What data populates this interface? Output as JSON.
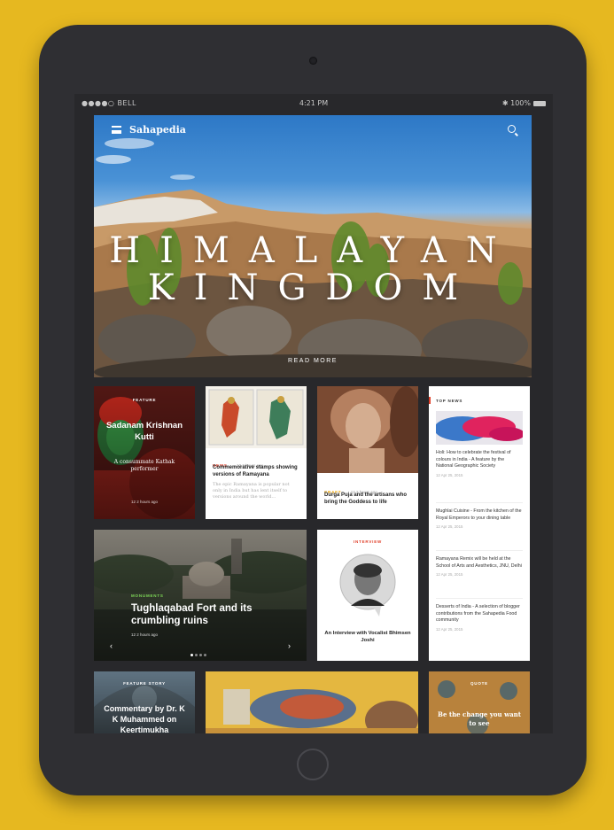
{
  "status_bar": {
    "carrier": "●●●●○ BELL",
    "time": "4:21 PM",
    "battery": "100%"
  },
  "app": {
    "logo": "Sahapedia"
  },
  "hero": {
    "title_line1": "HIMALAYAN",
    "title_line2": "KINGDOM",
    "cta": "READ MORE"
  },
  "cards": {
    "feature": {
      "tag": "FEATURE",
      "title": "Sadanam Krishnan Kutti",
      "subtitle": "A consummate Kathak performer",
      "meta": "12  2 hours ago"
    },
    "stamps": {
      "tag": "NEWS",
      "meta": "12   2 hours ago",
      "title": "Commemorative stamps showing versions of Ramayana",
      "excerpt": "The epic Ramayana is popular not only in India but has lent itself to versions around the world..."
    },
    "durga": {
      "tag": "CRAFT",
      "meta": "12   2 hours ago",
      "title": "Durga Puja and the artisans who bring the Goddess to life"
    },
    "top_news": {
      "heading": "TOP NEWS",
      "items": [
        {
          "title": "Holi: How to celebrate the festival of colours in India - A feature by the National Geographic Society",
          "meta": "12   Apr 25, 2015"
        },
        {
          "title": "Mughlai Cuisine - From the kitchen of the Royal Emperors to your dining table",
          "meta": "12   Apr 25, 2015"
        },
        {
          "title": "Ramayana Remix will be held at the School of Arts and Aesthetics, JNU, Delhi",
          "meta": "12   Apr 25, 2015"
        },
        {
          "title": "Desserts of India - A selection of blogger contributions from the Sahapedia Food community",
          "meta": "12   Apr 25, 2015"
        }
      ]
    },
    "monument": {
      "tag": "MONUMENTS",
      "title": "Tughlaqabad Fort and its crumbling ruins",
      "meta": "12   2 hours ago"
    },
    "interview": {
      "tag": "INTERVIEW",
      "title": "An Interview with Vocalist Bhimsen Joshi"
    },
    "feature_story": {
      "tag": "FEATURE STORY",
      "title": "Commentary by Dr. K K Muhammed on Keertimukha"
    },
    "quote": {
      "tag": "QUOTE",
      "title": "Be the change you want to see"
    }
  },
  "colors": {
    "device_bg": "#e6b820",
    "frame": "#2f2f33",
    "accent_red": "#e0402a",
    "accent_green": "#7ed957"
  }
}
